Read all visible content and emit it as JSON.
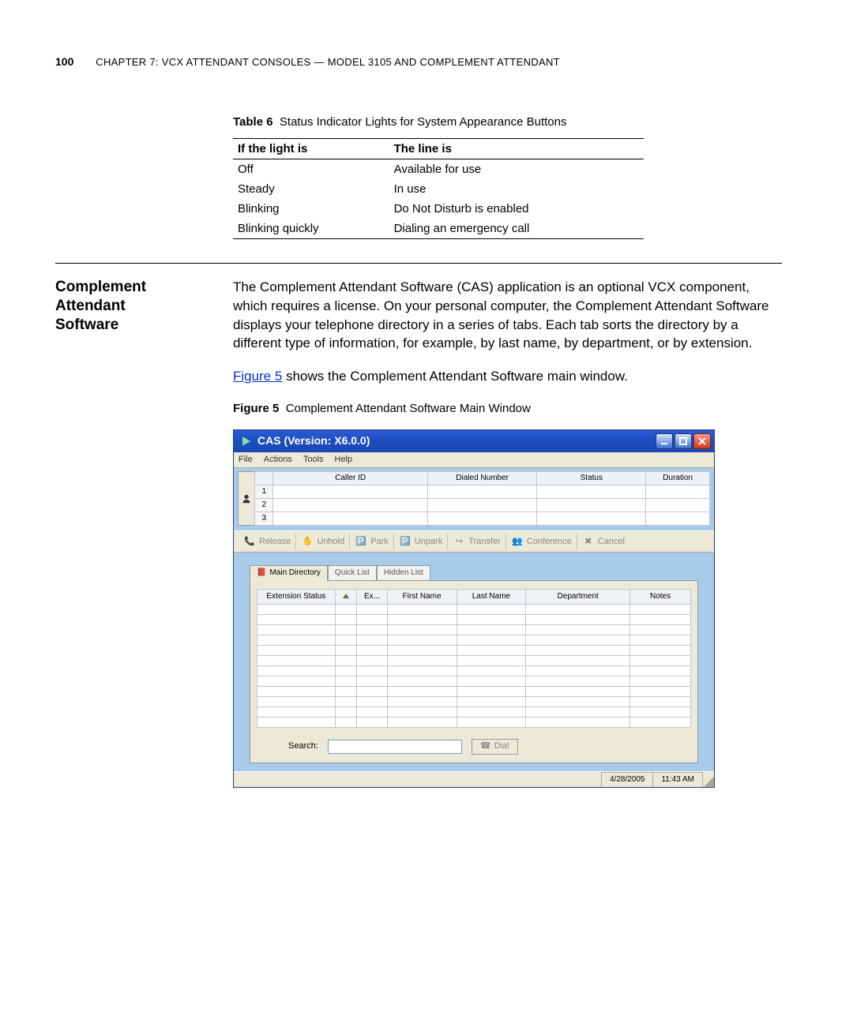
{
  "page_number": "100",
  "chapter_header": "CHAPTER 7: VCX ATTENDANT CONSOLES — MODEL 3105 AND COMPLEMENT ATTENDANT",
  "table6": {
    "caption_label": "Table 6",
    "caption_text": "Status Indicator Lights for System Appearance Buttons",
    "headers": [
      "If the light is",
      "The line is"
    ],
    "rows": [
      [
        "Off",
        "Available for use"
      ],
      [
        "Steady",
        "In use"
      ],
      [
        "Blinking",
        "Do Not Disturb is enabled"
      ],
      [
        "Blinking quickly",
        "Dialing an emergency call"
      ]
    ]
  },
  "section": {
    "title_l1": "Complement",
    "title_l2": "Attendant",
    "title_l3": "Software",
    "para1": "The Complement Attendant Software (CAS) application is an optional VCX component, which requires a license. On your personal computer, the Complement Attendant Software displays your telephone directory in a series of tabs. Each tab sorts the directory by a different type of information, for example, by last name, by department, or by extension.",
    "para2_prefix": "",
    "figlink": "Figure 5",
    "para2_suffix": " shows the Complement Attendant Software main window."
  },
  "figure5": {
    "label": "Figure 5",
    "text": "Complement Attendant Software Main Window"
  },
  "cas": {
    "title": "CAS  (Version: X6.0.0)",
    "menus": [
      "File",
      "Actions",
      "Tools",
      "Help"
    ],
    "callgrid": {
      "headers": [
        "Caller ID",
        "Dialed Number",
        "Status",
        "Duration"
      ],
      "rownums": [
        "1",
        "2",
        "3"
      ]
    },
    "toolbar": {
      "release": "Release",
      "unhold": "Unhold",
      "park": "Park",
      "unpark": "Unpark",
      "transfer": "Transfer",
      "conference": "Conference",
      "cancel": "Cancel"
    },
    "tabs": {
      "main": "Main Directory",
      "quick": "Quick List",
      "hidden": "Hidden List"
    },
    "dirgrid": {
      "headers": [
        "Extension Status",
        "",
        "Ex...",
        "First Name",
        "Last Name",
        "Department",
        "Notes"
      ]
    },
    "search_label": "Search:",
    "dial_label": "Dial",
    "status_date": "4/28/2005",
    "status_time": "11:43 AM"
  }
}
